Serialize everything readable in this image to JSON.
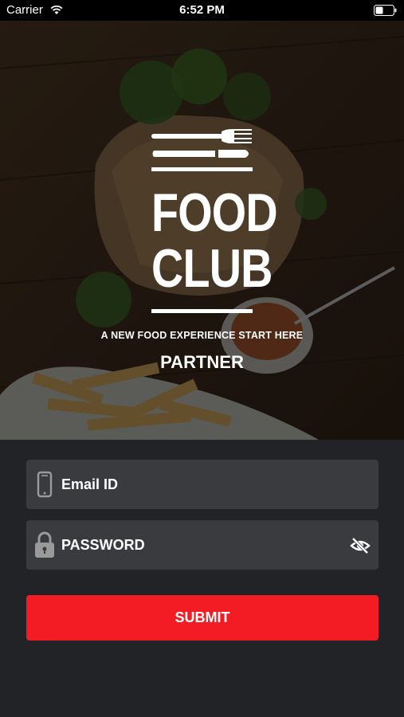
{
  "status_bar": {
    "carrier": "Carrier",
    "time": "6:52 PM"
  },
  "brand": {
    "logo_line1": "FOOD",
    "logo_line2": "CLUB",
    "tagline": "A NEW FOOD EXPERIENCE START HERE",
    "subtitle": "PARTNER"
  },
  "form": {
    "email": {
      "placeholder": "Email ID",
      "icon": "phone-icon"
    },
    "password": {
      "placeholder": "PASSWORD",
      "icon": "lock-icon",
      "toggle_icon": "eye-off-icon"
    },
    "submit_label": "SUBMIT"
  },
  "colors": {
    "accent": "#f41c24",
    "background": "#222326",
    "field": "#3a3b3e"
  }
}
